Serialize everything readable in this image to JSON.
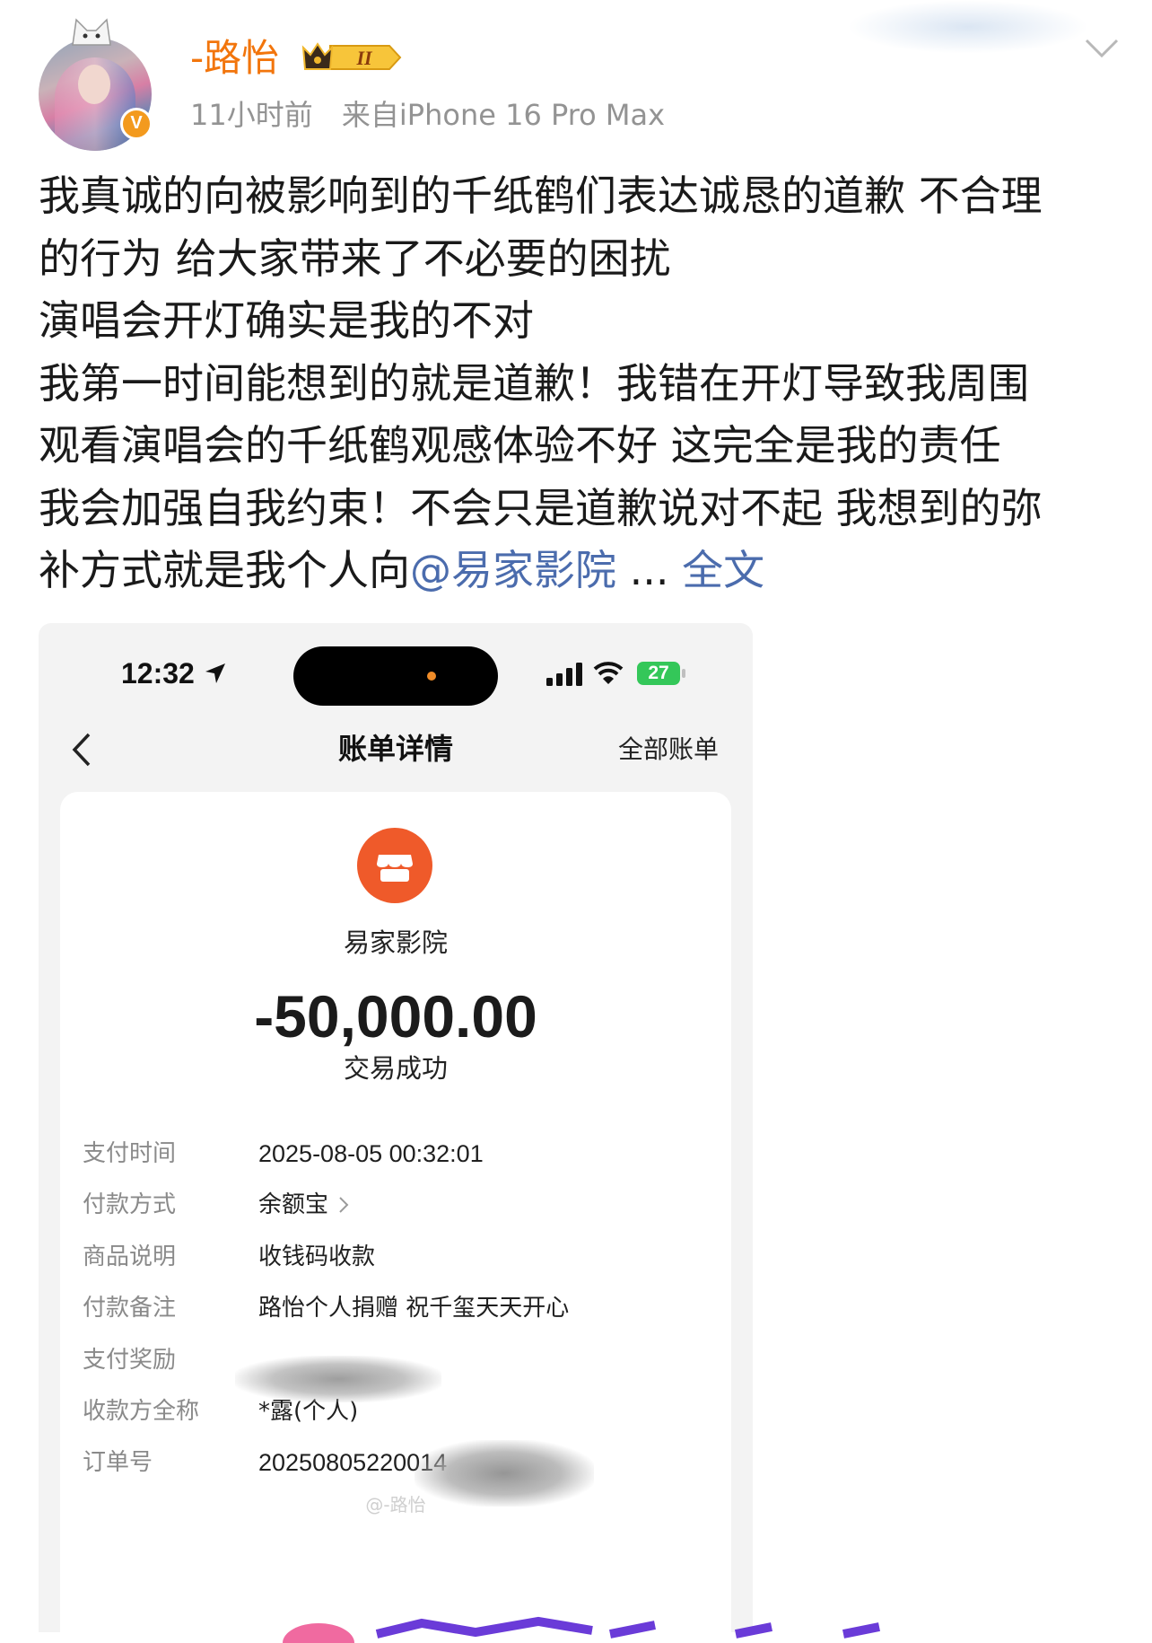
{
  "post": {
    "user": {
      "name": "-路怡",
      "level_badge": "II",
      "verified_mark": "V"
    },
    "meta": {
      "time": "11小时前",
      "source": "来自iPhone 16 Pro Max"
    },
    "text_lines": [
      "我真诚的向被影响到的千纸鹤们表达诚恳的道歉 不合理",
      "的行为 给大家带来了不必要的困扰",
      "演唱会开灯确实是我的不对",
      "我第一时间能想到的就是道歉！我错在开灯导致我周围",
      "观看演唱会的千纸鹤观感体验不好 这完全是我的责任",
      "我会加强自我约束！不会只是道歉说对不起 我想到的弥"
    ],
    "last_line_prefix": "补方式就是我个人向",
    "mention": "@易家影院",
    "ellipsis": " ... ",
    "more_link": "全文"
  },
  "screenshot": {
    "status_bar": {
      "time": "12:32",
      "battery": "27"
    },
    "nav": {
      "title": "账单详情",
      "right_link": "全部账单"
    },
    "merchant": "易家影院",
    "amount": "-50,000.00",
    "status": "交易成功",
    "details": [
      {
        "label": "支付时间",
        "value": "2025-08-05 00:32:01"
      },
      {
        "label": "付款方式",
        "value": "余额宝"
      },
      {
        "label": "商品说明",
        "value": "收钱码收款"
      },
      {
        "label": "付款备注",
        "value": "路怡个人捐赠 祝千玺天天开心"
      },
      {
        "label": "支付奖励",
        "value": ""
      },
      {
        "label": "收款方全称",
        "value": "*露(个人)"
      },
      {
        "label": "订单号",
        "value": "20250805220014"
      }
    ],
    "watermark": "@-路怡"
  },
  "colors": {
    "username": "#f2750c",
    "link": "#4b6cad",
    "merchant_icon": "#ef5a2a",
    "battery": "#34c759"
  },
  "icons": [
    "avatar",
    "verified-icon",
    "vip-badge-icon",
    "chevron-down-icon",
    "location-arrow-icon",
    "signal-icon",
    "wifi-icon",
    "battery-icon",
    "back-arrow-icon",
    "shop-icon",
    "chevron-right-icon"
  ]
}
